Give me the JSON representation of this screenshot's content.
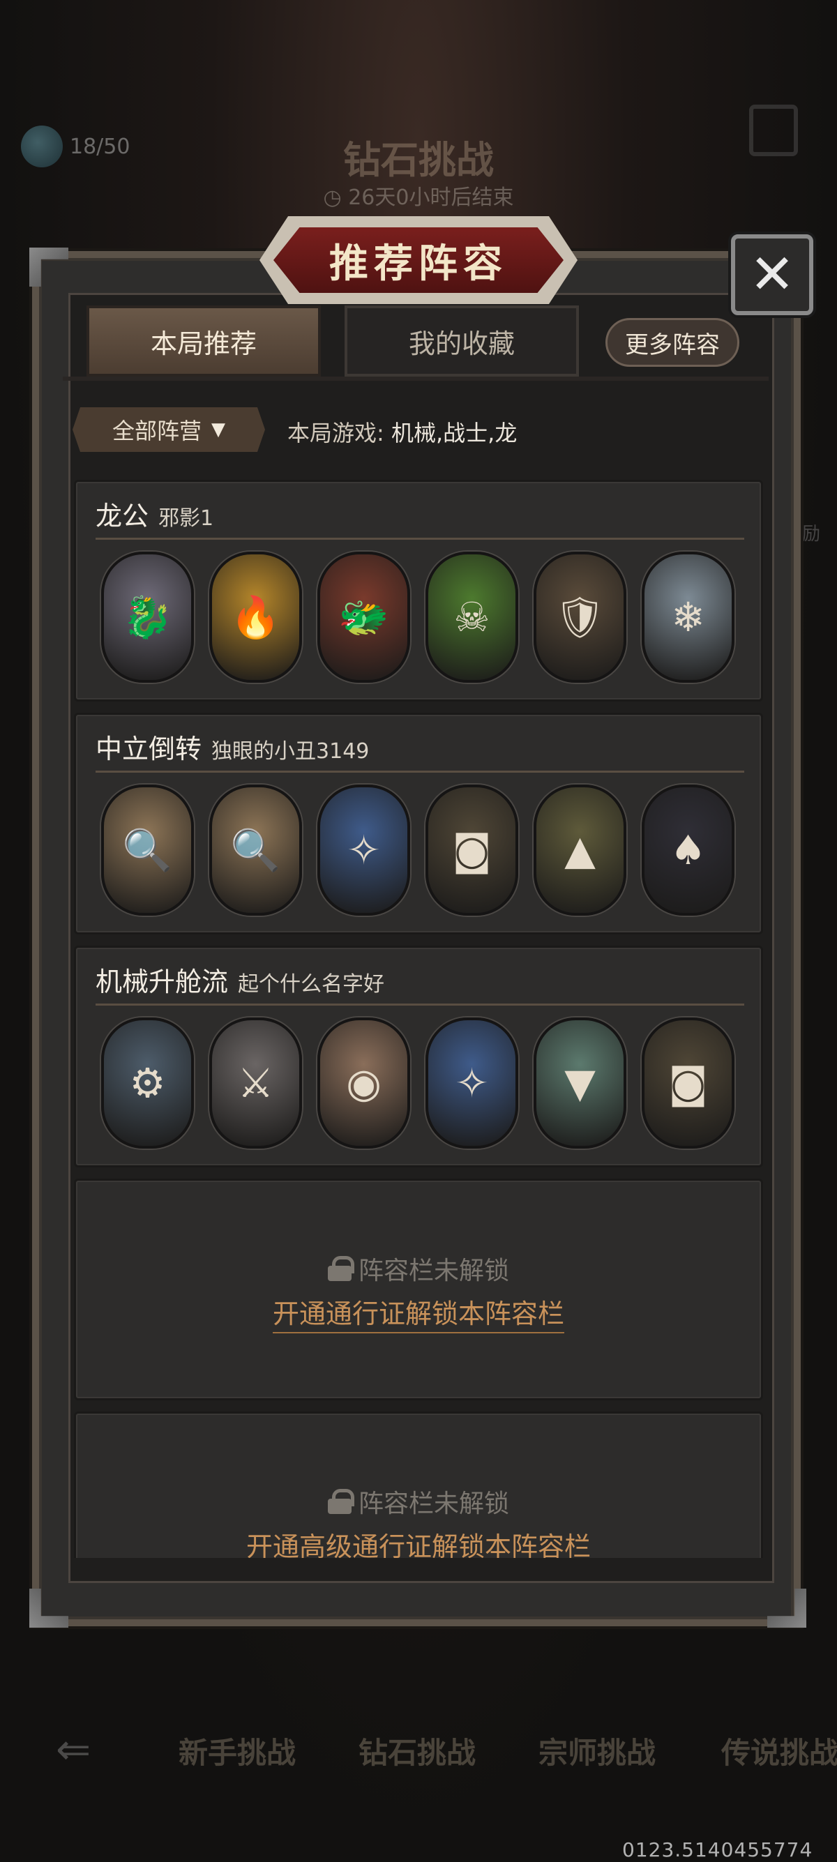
{
  "background": {
    "resource_count": "18/50",
    "screen_title": "钻石挑战",
    "timer": "26天0小时后结束",
    "side_text": "励",
    "nav": [
      "新手挑战",
      "钻石挑战",
      "宗师挑战",
      "传说挑战"
    ],
    "footer": "0123.5140455774"
  },
  "modal": {
    "title": "推荐阵容",
    "close_icon": "close-icon",
    "tabs": {
      "current": "本局推荐",
      "favorites": "我的收藏",
      "more": "更多阵容"
    },
    "filter": {
      "label": "全部阵营",
      "game_info_label": "本局游戏:",
      "game_info_value": "机械,战士,龙"
    },
    "lineups": [
      {
        "name": "龙公",
        "author": "邪影1",
        "heroes": [
          {
            "icon": "dragon-icon",
            "color": "#6e6a78"
          },
          {
            "icon": "fire-mage-icon",
            "color": "#b5862a"
          },
          {
            "icon": "red-dragon-icon",
            "color": "#7a3a2c"
          },
          {
            "icon": "poison-dragon-icon",
            "color": "#4d7a2e"
          },
          {
            "icon": "shield-knight-icon",
            "color": "#5a4b3a"
          },
          {
            "icon": "blue-dragon-icon",
            "color": "#7d8a94"
          }
        ]
      },
      {
        "name": "中立倒转",
        "author": "独眼的小丑3149",
        "heroes": [
          {
            "icon": "detective-icon",
            "color": "#8c7456"
          },
          {
            "icon": "detective-icon",
            "color": "#8c7456"
          },
          {
            "icon": "elf-sorceress-icon",
            "color": "#3f5b8a"
          },
          {
            "icon": "treasure-mimic-icon",
            "color": "#4f4636"
          },
          {
            "icon": "witch-hat-icon",
            "color": "#5e5a3a"
          },
          {
            "icon": "magician-icon",
            "color": "#2f2e36"
          }
        ]
      },
      {
        "name": "机械升舱流",
        "author": "起个什么名字好",
        "heroes": [
          {
            "icon": "robot-icon",
            "color": "#4d5c6a"
          },
          {
            "icon": "knight-helmet-icon",
            "color": "#6a6564"
          },
          {
            "icon": "cyborg-icon",
            "color": "#8a6e5a"
          },
          {
            "icon": "elf-sorceress-icon",
            "color": "#3f5b8a"
          },
          {
            "icon": "shark-icon",
            "color": "#5c7a6e"
          },
          {
            "icon": "treasure-mimic-icon",
            "color": "#4f4636"
          }
        ]
      }
    ],
    "locked_slots": [
      {
        "text": "阵容栏未解锁",
        "link": "开通通行证解锁本阵容栏"
      },
      {
        "text": "阵容栏未解锁",
        "link": "开通高级通行证解锁本阵容栏"
      }
    ]
  }
}
